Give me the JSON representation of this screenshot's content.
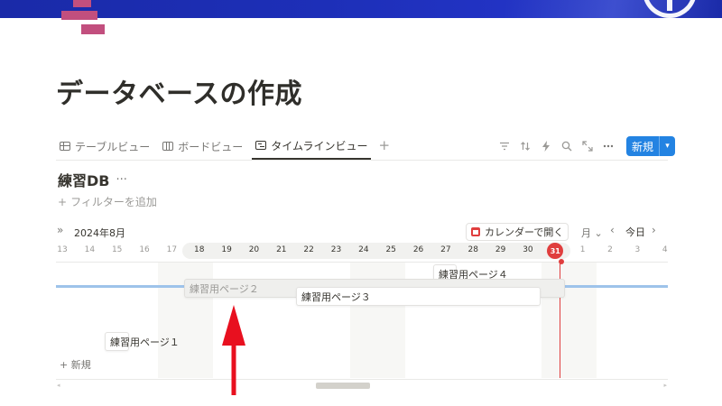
{
  "page": {
    "title": "データベースの作成"
  },
  "views": {
    "tabs": [
      {
        "label": "テーブルビュー",
        "icon": "table-icon"
      },
      {
        "label": "ボードビュー",
        "icon": "board-icon"
      },
      {
        "label": "タイムラインビュー",
        "icon": "timeline-icon",
        "active": true
      }
    ],
    "add": "+"
  },
  "toolbar": {
    "icons": [
      "filter-icon",
      "sort-icon",
      "automation-icon",
      "search-icon",
      "expand-icon",
      "more-icon"
    ],
    "new_label": "新規",
    "new_dropdown": "▾",
    "accent": "#2383e2"
  },
  "database": {
    "title": "練習DB",
    "more": "···",
    "add_filter": "フィルターを追加"
  },
  "timeline": {
    "month_label": "2024年8月",
    "calendar_button": "カレンダーで開く",
    "scale_select": "月",
    "today_button": "今日",
    "today_color": "#e03e3e",
    "days": [
      "13",
      "14",
      "15",
      "16",
      "17",
      "18",
      "19",
      "20",
      "21",
      "22",
      "23",
      "24",
      "25",
      "26",
      "27",
      "28",
      "29",
      "30",
      "31",
      "1",
      "2",
      "3",
      "4"
    ],
    "today": "31",
    "cards": [
      {
        "label": "練習用ページ４"
      },
      {
        "label": "練習用ページ２"
      },
      {
        "label": "練習用ページ３"
      },
      {
        "label": "練習用ページ１"
      }
    ],
    "new_row": "新規"
  }
}
